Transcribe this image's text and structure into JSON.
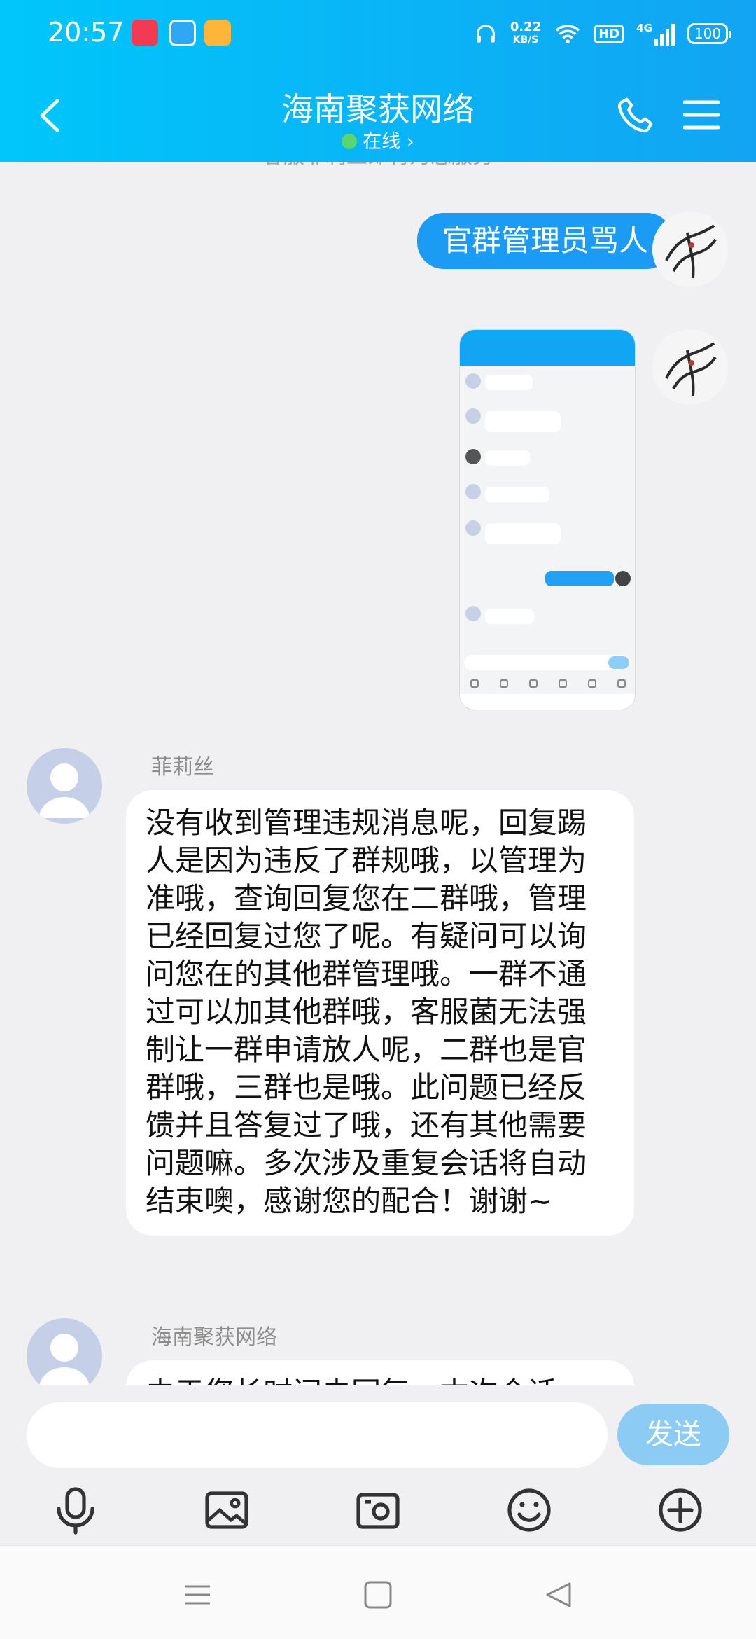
{
  "status_bar": {
    "time": "20:57",
    "net_speed_value": "0.22",
    "net_speed_unit": "KB/S",
    "hd_label": "HD",
    "signal_label": "4G",
    "battery": "100"
  },
  "header": {
    "title": "海南聚获网络",
    "status": "在线",
    "status_chevron": "›"
  },
  "chat": {
    "system_note": "客服菲莉丝即将为您服务",
    "messages": [
      {
        "side": "right",
        "type": "text",
        "text": "官群管理员骂人"
      },
      {
        "side": "right",
        "type": "image"
      },
      {
        "side": "left",
        "sender": "菲莉丝",
        "text": "没有收到管理违规消息呢，回复踢人是因为违反了群规哦，以管理为准哦，查询回复您在二群哦，管理已经回复过您了呢。有疑问可以询问您在的其他群管理哦。一群不通过可以加其他群哦，客服菌无法强制让一群申请放人呢，二群也是官群哦，三群也是哦。此问题已经反馈并且答复过了哦，还有其他需要问题嘛。多次涉及重复会话将自动结束噢，感谢您的配合！谢谢~"
      },
      {
        "side": "left",
        "sender": "海南聚获网络",
        "text": "由于您长时间未回复，本次会话"
      }
    ]
  },
  "input_bar": {
    "placeholder": "",
    "send_label": "发送"
  },
  "colors": {
    "header_start": "#00c6fb",
    "header_end": "#12a4f2",
    "bubble_self": "#1c9bf5",
    "send_button": "#8ccbf4",
    "online_dot": "#5ad56f"
  },
  "icons": [
    "back-icon",
    "phone-icon",
    "menu-icon",
    "voice-icon",
    "image-icon",
    "camera-icon",
    "emoji-icon",
    "plus-icon"
  ]
}
